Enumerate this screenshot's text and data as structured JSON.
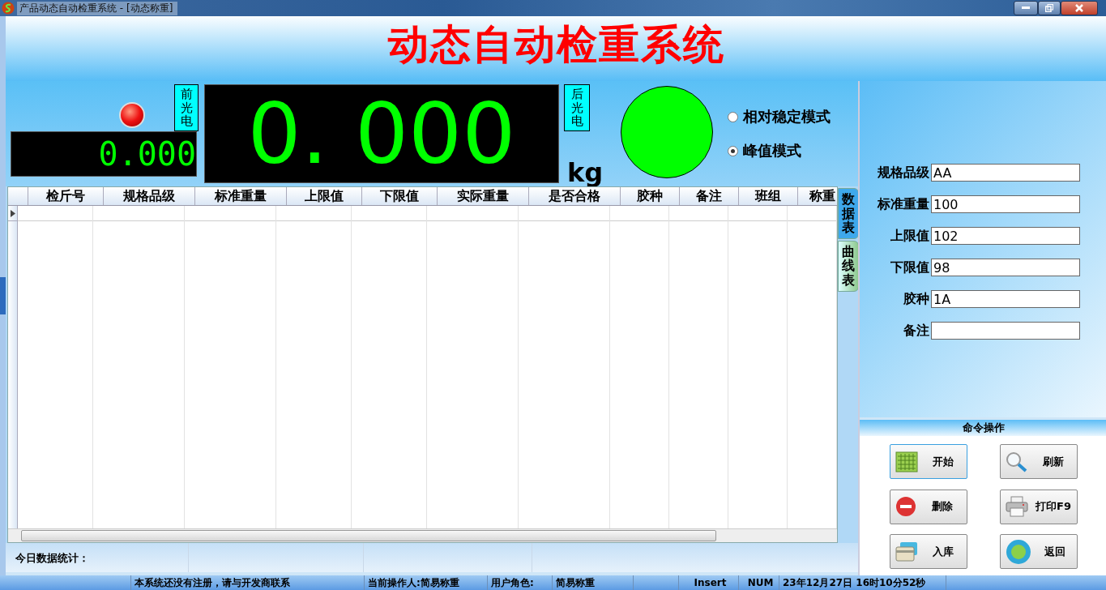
{
  "window": {
    "title": "产品动态自动检重系统 - [动态称重]"
  },
  "header": {
    "title": "动态自动检重系统"
  },
  "front_sensor": {
    "label": "前光电"
  },
  "small_display": {
    "value": "0.000"
  },
  "main_display": {
    "value": "0. 000",
    "unit": "kg"
  },
  "rear_sensor": {
    "label": "后光电"
  },
  "modes": [
    {
      "label": "相对稳定模式",
      "selected": false
    },
    {
      "label": "峰值模式",
      "selected": true
    }
  ],
  "table": {
    "columns": [
      "检斤号",
      "规格品级",
      "标准重量",
      "上限值",
      "下限值",
      "实际重量",
      "是否合格",
      "胶种",
      "备注",
      "班组",
      "称重"
    ]
  },
  "tabs": [
    {
      "label": "数据表",
      "selected": true
    },
    {
      "label": "曲线表",
      "selected": false
    }
  ],
  "form": [
    {
      "label": "规格品级",
      "value": "AA"
    },
    {
      "label": "标准重量",
      "value": "100"
    },
    {
      "label": "上限值",
      "value": "102"
    },
    {
      "label": "下限值",
      "value": "98"
    },
    {
      "label": "胶种",
      "value": "1A"
    },
    {
      "label": "备注"
    }
  ],
  "commands": {
    "title": "命令操作",
    "buttons": [
      {
        "label": "开始",
        "kind": "start",
        "focused": true
      },
      {
        "label": "刷新",
        "kind": "refresh",
        "focused": false
      },
      {
        "label": "删除",
        "kind": "delete",
        "focused": false
      },
      {
        "label": "打印F9",
        "kind": "print",
        "focused": false
      },
      {
        "label": "入库",
        "kind": "store",
        "focused": false
      },
      {
        "label": "返回",
        "kind": "back",
        "focused": false
      }
    ]
  },
  "stats": {
    "label": "今日数据统计："
  },
  "status_bar": [
    "本系统还没有注册，请与开发商联系",
    "当前操作人:简易称重",
    "用户角色:",
    "简易称重",
    "Insert",
    "NUM",
    "23年12月27日  16时10分52秒"
  ]
}
